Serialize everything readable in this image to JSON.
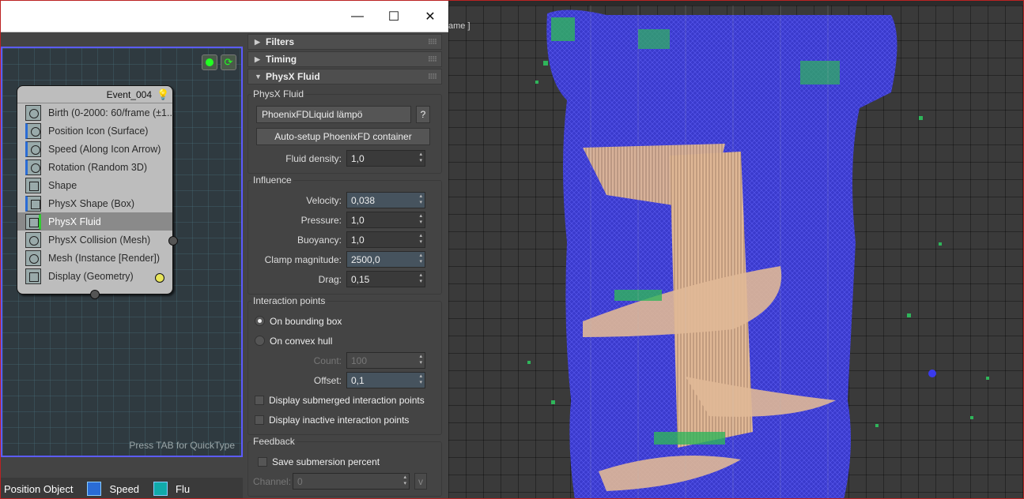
{
  "window": {
    "minimize": "—",
    "maximize": "☐",
    "close": "✕"
  },
  "particle_view": {
    "event": {
      "name": "Event_004",
      "operators": [
        {
          "label": "Birth (0-2000: 60/frame (±1..."
        },
        {
          "label": "Position Icon (Surface)"
        },
        {
          "label": "Speed (Along Icon Arrow)"
        },
        {
          "label": "Rotation (Random 3D)"
        },
        {
          "label": "Shape"
        },
        {
          "label": "PhysX Shape (Box)"
        },
        {
          "label": "PhysX Fluid"
        },
        {
          "label": "PhysX Collision (Mesh)"
        },
        {
          "label": "Mesh (Instance [Render])"
        },
        {
          "label": "Display (Geometry)"
        }
      ]
    },
    "quicktype_hint": "Press TAB for QuickType",
    "depot": [
      "Position Object",
      "Speed",
      "Flu"
    ]
  },
  "params": {
    "rollouts": {
      "filters": "Filters",
      "timing": "Timing",
      "physx_fluid": "PhysX Fluid"
    },
    "fluid_group": {
      "title": "PhysX Fluid",
      "liquid_name": "PhoenixFDLiquid lämpö",
      "help": "?",
      "autosetup": "Auto-setup PhoenixFD container",
      "density_label": "Fluid density:",
      "density": "1,0"
    },
    "influence": {
      "title": "Influence",
      "velocity_label": "Velocity:",
      "velocity": "0,038",
      "pressure_label": "Pressure:",
      "pressure": "1,0",
      "buoyancy_label": "Buoyancy:",
      "buoyancy": "1,0",
      "clamp_label": "Clamp magnitude:",
      "clamp": "2500,0",
      "drag_label": "Drag:",
      "drag": "0,15"
    },
    "interaction": {
      "title": "Interaction points",
      "bbox": "On bounding box",
      "hull": "On convex hull",
      "count_label": "Count:",
      "count": "100",
      "offset_label": "Offset:",
      "offset": "0,1",
      "submerged": "Display submerged interaction points",
      "inactive": "Display inactive interaction points"
    },
    "feedback": {
      "title": "Feedback",
      "save": "Save submersion percent",
      "channel_label": "Channel:",
      "channel": "0",
      "channel_btn": "v"
    }
  },
  "viewport": {
    "label": "ame ]"
  }
}
